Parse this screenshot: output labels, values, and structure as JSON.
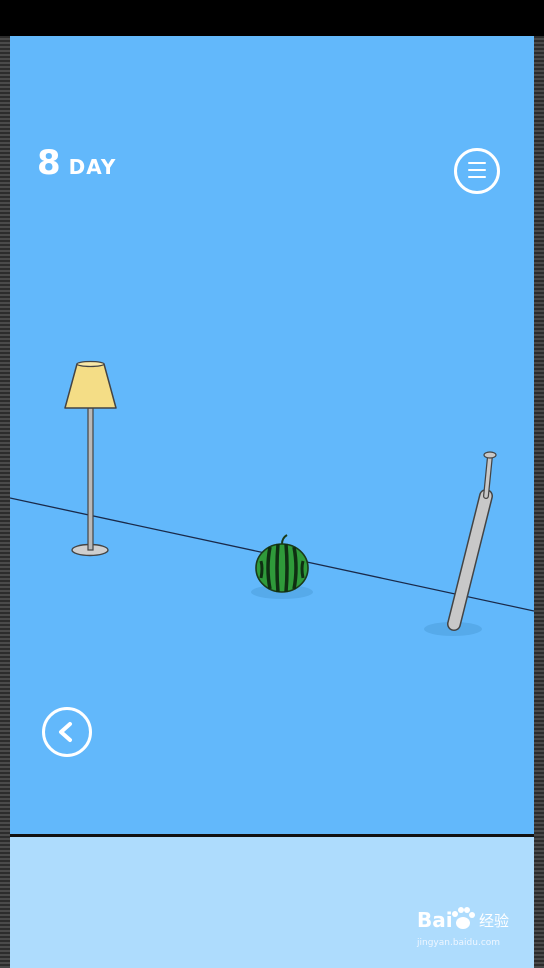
{
  "hud": {
    "day_number": "8",
    "day_label": "DAY"
  },
  "icons": {
    "menu": "hamburger-menu-icon",
    "back": "chevron-left-icon"
  },
  "scene": {
    "items": [
      "floor-lamp",
      "watermelon",
      "baseball-bat"
    ]
  },
  "watermark": {
    "brand": "Bai",
    "brand_cn": "经验",
    "url": "jingyan.baidu.com"
  },
  "colors": {
    "stage_background": "#62b8fb",
    "bottom_panel": "#aedcfd",
    "lamp_shade": "#f4dd86",
    "watermelon": "#2f9a3a",
    "bat": "#c8c8c8"
  }
}
